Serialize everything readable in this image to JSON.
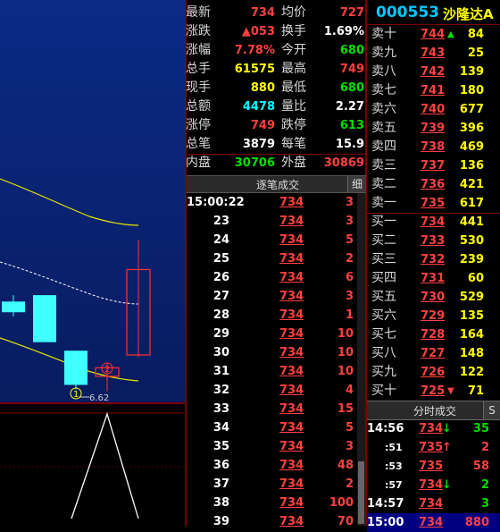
{
  "chart": {
    "low_label": "6.62",
    "marker_1": "1",
    "marker_2": "2",
    "candles": [
      {
        "open": 7.05,
        "close": 7.0,
        "high": 7.08,
        "low": 6.98,
        "color": "cyan"
      },
      {
        "open": 7.08,
        "close": 6.86,
        "high": 7.08,
        "low": 6.86,
        "color": "cyan"
      },
      {
        "open": 6.82,
        "close": 6.66,
        "high": 6.82,
        "low": 6.64,
        "color": "cyan"
      },
      {
        "open": 6.7,
        "close": 6.74,
        "high": 6.76,
        "low": 6.63,
        "color": "red"
      },
      {
        "open": 6.8,
        "close": 7.2,
        "high": 7.34,
        "low": 6.79,
        "color": "red"
      }
    ]
  },
  "stock": {
    "code": "000553",
    "name": "沙隆达A"
  },
  "quote": [
    {
      "l1": "最新",
      "v1": "734",
      "c1": "red",
      "l2": "均价",
      "v2": "727",
      "c2": "red"
    },
    {
      "l1": "涨跌",
      "v1": "▲053",
      "c1": "red",
      "l2": "换手",
      "v2": "1.69%",
      "c2": "wht"
    },
    {
      "l1": "涨幅",
      "v1": "7.78%",
      "c1": "red",
      "l2": "今开",
      "v2": "680",
      "c2": "grn"
    },
    {
      "l1": "总手",
      "v1": "61575",
      "c1": "yel",
      "l2": "最高",
      "v2": "749",
      "c2": "red"
    },
    {
      "l1": "现手",
      "v1": "880",
      "c1": "yel",
      "l2": "最低",
      "v2": "680",
      "c2": "grn"
    },
    {
      "l1": "总额",
      "v1": "4478",
      "c1": "cyan",
      "l2": "量比",
      "v2": "2.27",
      "c2": "wht"
    },
    {
      "l1": "涨停",
      "v1": "749",
      "c1": "red",
      "l2": "跌停",
      "v2": "613",
      "c2": "grn"
    },
    {
      "l1": "总笔",
      "v1": "3879",
      "c1": "wht",
      "l2": "每笔",
      "v2": "15.9",
      "c2": "wht"
    },
    {
      "l1": "内盘",
      "v1": "30706",
      "c1": "grn",
      "l2": "外盘",
      "v2": "30869",
      "c2": "red"
    }
  ],
  "tape": {
    "title": "逐笔成交",
    "detail_btn": "细",
    "rows": [
      {
        "t": "15:00:22",
        "p": "734",
        "v": "3"
      },
      {
        "t": "23",
        "p": "734",
        "v": "3"
      },
      {
        "t": "24",
        "p": "734",
        "v": "5"
      },
      {
        "t": "25",
        "p": "734",
        "v": "2"
      },
      {
        "t": "26",
        "p": "734",
        "v": "6"
      },
      {
        "t": "27",
        "p": "734",
        "v": "3"
      },
      {
        "t": "28",
        "p": "734",
        "v": "1"
      },
      {
        "t": "29",
        "p": "734",
        "v": "10"
      },
      {
        "t": "30",
        "p": "734",
        "v": "10"
      },
      {
        "t": "31",
        "p": "734",
        "v": "10"
      },
      {
        "t": "32",
        "p": "734",
        "v": "4"
      },
      {
        "t": "33",
        "p": "734",
        "v": "15"
      },
      {
        "t": "34",
        "p": "734",
        "v": "5"
      },
      {
        "t": "35",
        "p": "734",
        "v": "3"
      },
      {
        "t": "36",
        "p": "734",
        "v": "48"
      },
      {
        "t": "37",
        "p": "734",
        "v": "2"
      },
      {
        "t": "38",
        "p": "734",
        "v": "100"
      },
      {
        "t": "39",
        "p": "734",
        "v": "70"
      }
    ]
  },
  "book": [
    {
      "l": "卖十",
      "p": "744",
      "a": "▲",
      "ac": "grn",
      "v": "84"
    },
    {
      "l": "卖九",
      "p": "743",
      "a": "",
      "ac": "",
      "v": "25"
    },
    {
      "l": "卖八",
      "p": "742",
      "a": "",
      "ac": "",
      "v": "139"
    },
    {
      "l": "卖七",
      "p": "741",
      "a": "",
      "ac": "",
      "v": "180"
    },
    {
      "l": "卖六",
      "p": "740",
      "a": "",
      "ac": "",
      "v": "677"
    },
    {
      "l": "卖五",
      "p": "739",
      "a": "",
      "ac": "",
      "v": "396"
    },
    {
      "l": "卖四",
      "p": "738",
      "a": "",
      "ac": "",
      "v": "469"
    },
    {
      "l": "卖三",
      "p": "737",
      "a": "",
      "ac": "",
      "v": "136"
    },
    {
      "l": "卖二",
      "p": "736",
      "a": "",
      "ac": "",
      "v": "421"
    },
    {
      "l": "卖一",
      "p": "735",
      "a": "",
      "ac": "",
      "v": "617"
    },
    {
      "l": "买一",
      "p": "734",
      "a": "",
      "ac": "",
      "v": "441"
    },
    {
      "l": "买二",
      "p": "733",
      "a": "",
      "ac": "",
      "v": "530"
    },
    {
      "l": "买三",
      "p": "732",
      "a": "",
      "ac": "",
      "v": "239"
    },
    {
      "l": "买四",
      "p": "731",
      "a": "",
      "ac": "",
      "v": "60"
    },
    {
      "l": "买五",
      "p": "730",
      "a": "",
      "ac": "",
      "v": "529"
    },
    {
      "l": "买六",
      "p": "729",
      "a": "",
      "ac": "",
      "v": "135"
    },
    {
      "l": "买七",
      "p": "728",
      "a": "",
      "ac": "",
      "v": "164"
    },
    {
      "l": "买八",
      "p": "727",
      "a": "",
      "ac": "",
      "v": "148"
    },
    {
      "l": "买九",
      "p": "726",
      "a": "",
      "ac": "",
      "v": "122"
    },
    {
      "l": "买十",
      "p": "725",
      "a": "▼",
      "ac": "red",
      "v": "71"
    }
  ],
  "ticks": {
    "title": "分时成交",
    "expand_btn": "S",
    "rows": [
      {
        "t": "14:56",
        "p": "734",
        "a": "↓",
        "ac": "grn",
        "v": "35",
        "vc": "grn"
      },
      {
        "t": ":51",
        "p": "735",
        "a": "↑",
        "ac": "red",
        "v": "2",
        "vc": "red"
      },
      {
        "t": ":53",
        "p": "735",
        "a": "",
        "ac": "",
        "v": "58",
        "vc": "red"
      },
      {
        "t": ":57",
        "p": "734",
        "a": "↓",
        "ac": "grn",
        "v": "2",
        "vc": "grn"
      },
      {
        "t": "14:57",
        "p": "734",
        "a": "",
        "ac": "",
        "v": "3",
        "vc": "grn"
      },
      {
        "t": "15:00",
        "p": "734",
        "a": "",
        "ac": "",
        "v": "880",
        "vc": "red"
      }
    ]
  }
}
